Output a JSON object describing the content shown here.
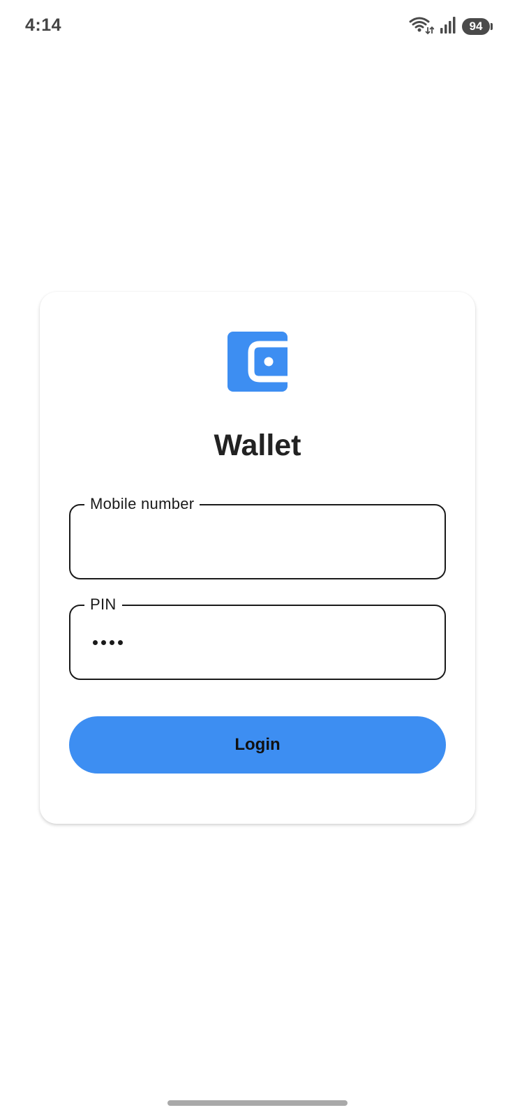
{
  "status_bar": {
    "time": "4:14",
    "battery_level": "94",
    "icons": [
      "wifi-icon",
      "signal-icon",
      "battery-icon"
    ]
  },
  "login_card": {
    "logo_icon": "wallet-icon",
    "title": "Wallet",
    "mobile_field": {
      "label": "Mobile number",
      "value": ""
    },
    "pin_field": {
      "label": "PIN",
      "value": "••••",
      "length": 4
    },
    "login_label": "Login"
  },
  "colors": {
    "accent": "#3d8ef2",
    "text": "#222222",
    "field_border": "#1a1a1a",
    "background": "#ffffff"
  }
}
